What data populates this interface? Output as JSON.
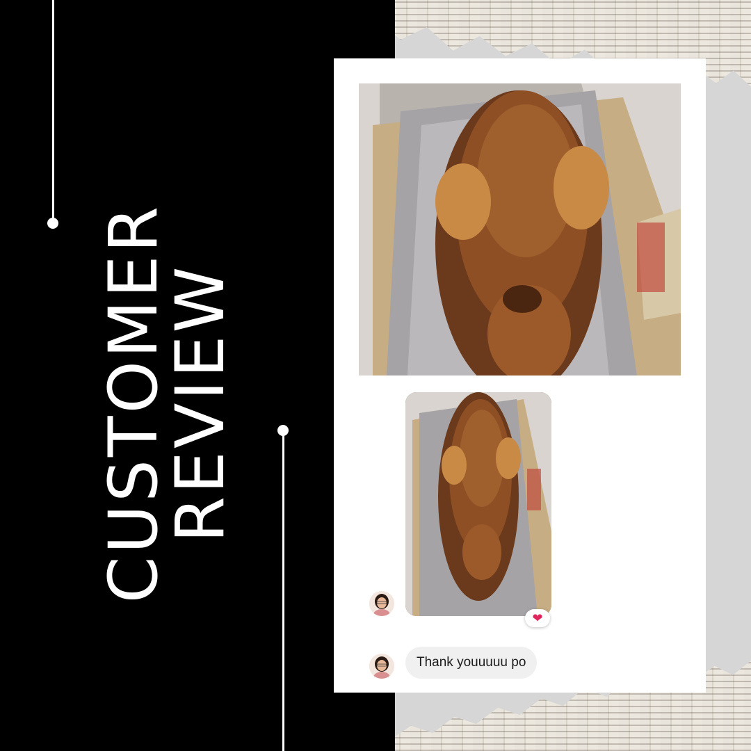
{
  "title": {
    "line1": "CUSTOMER",
    "line2": "REVIEW"
  },
  "message": {
    "text": "Thank youuuuu po",
    "reaction": "❤"
  },
  "icons": {
    "reaction": "heart-icon",
    "avatar": "avatar-icon"
  },
  "colors": {
    "panel": "#000000",
    "background": "#d6d6d6",
    "card": "#ffffff",
    "bubble": "#f0f0f0",
    "heart": "#e0245e"
  }
}
